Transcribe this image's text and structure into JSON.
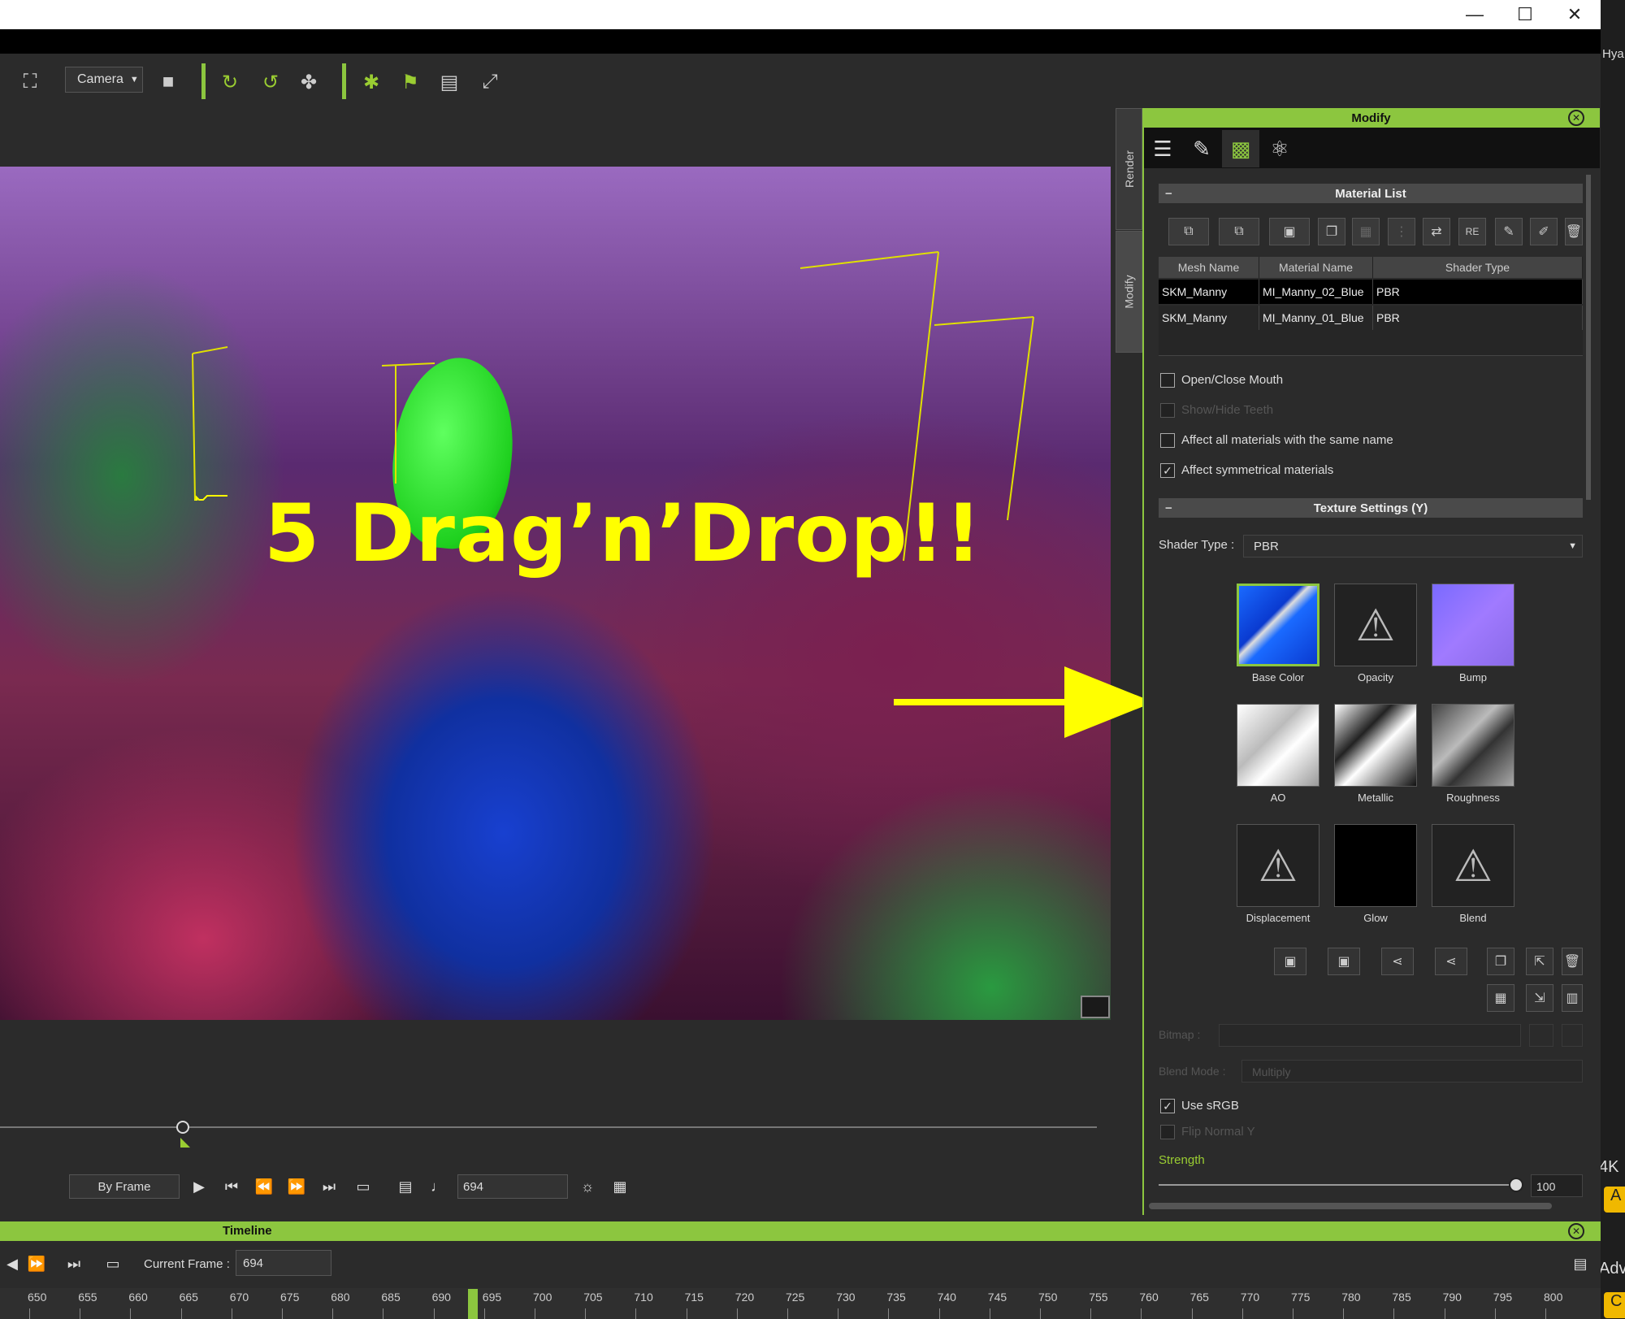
{
  "window": {
    "minimize": "—",
    "maximize": "☐",
    "close": "✕"
  },
  "edge_text": {
    "top": "Hya",
    "mid": "4K",
    "btn1": "A",
    "adv": "Adv",
    "btn2": "C"
  },
  "toolbar": {
    "camera_label": "Camera"
  },
  "viewport": {
    "overlay_text": "5 Drag’n’Drop!!"
  },
  "playback": {
    "mode": "By Frame",
    "frame": "694"
  },
  "side_tabs": {
    "render": "Render",
    "modify": "Modify"
  },
  "modify_panel": {
    "title": "Modify",
    "material_list_title": "Material List",
    "columns": [
      "Mesh Name",
      "Material Name",
      "Shader Type"
    ],
    "rows": [
      {
        "mesh": "SKM_Manny",
        "material": "MI_Manny_02_Blue",
        "shader": "PBR"
      },
      {
        "mesh": "SKM_Manny",
        "material": "MI_Manny_01_Blue",
        "shader": "PBR"
      }
    ],
    "checkboxes": [
      {
        "label": "Open/Close Mouth",
        "checked": false,
        "enabled": true
      },
      {
        "label": "Show/Hide Teeth",
        "checked": false,
        "enabled": false
      },
      {
        "label": "Affect all materials with the same name",
        "checked": false,
        "enabled": true
      },
      {
        "label": "Affect symmetrical materials",
        "checked": true,
        "enabled": true
      }
    ],
    "texture_settings_title": "Texture Settings (Y)",
    "shader_type_label": "Shader Type :",
    "shader_type_value": "PBR",
    "textures": [
      "Base Color",
      "Opacity",
      "Bump",
      "AO",
      "Metallic",
      "Roughness",
      "Displacement",
      "Glow",
      "Blend"
    ],
    "bitmap_label": "Bitmap :",
    "blend_mode_label": "Blend Mode :",
    "blend_mode_value": "Multiply",
    "use_srgb_label": "Use sRGB",
    "flip_normal_label": "Flip Normal Y",
    "strength_label": "Strength",
    "strength_value": "100"
  },
  "timeline": {
    "title": "Timeline",
    "current_frame_label": "Current Frame :",
    "current_frame": "694",
    "ruler_marks": [
      "650",
      "655",
      "660",
      "665",
      "670",
      "675",
      "680",
      "685",
      "690",
      "695",
      "700",
      "705",
      "710",
      "715",
      "720",
      "725",
      "730",
      "735",
      "740",
      "745",
      "750",
      "755",
      "760",
      "765",
      "770",
      "775",
      "780",
      "785",
      "790",
      "795",
      "800"
    ]
  },
  "colors": {
    "accent": "#8cc63f",
    "overlay_yellow": "#ffff00"
  }
}
